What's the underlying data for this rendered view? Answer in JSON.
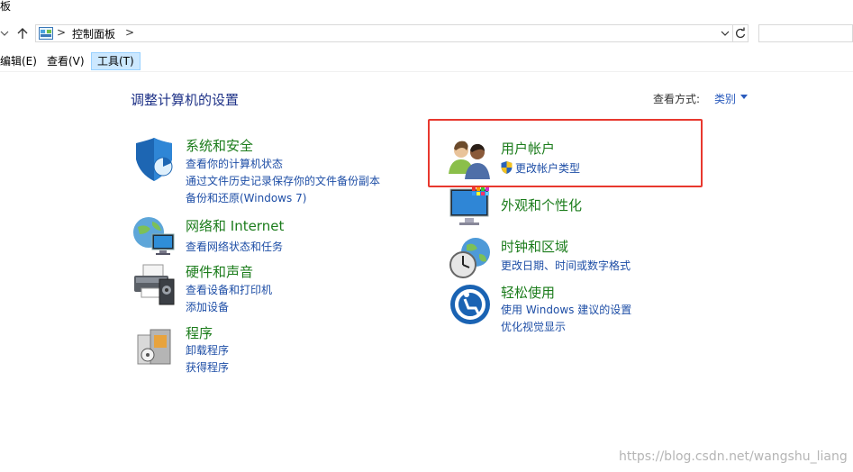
{
  "window": {
    "title": "板"
  },
  "address": {
    "crumb": "控制面板",
    "separator": ">"
  },
  "menu": {
    "edit": "编辑(E)",
    "view": "查看(V)",
    "tools": "工具(T)"
  },
  "main": {
    "heading": "调整计算机的设置",
    "view_by_label": "查看方式:",
    "view_by_value": "类别"
  },
  "categories": {
    "security": {
      "title": "系统和安全",
      "links": [
        "查看你的计算机状态",
        "通过文件历史记录保存你的文件备份副本",
        "备份和还原(Windows 7)"
      ]
    },
    "network": {
      "title": "网络和 Internet",
      "links": [
        "查看网络状态和任务"
      ]
    },
    "hardware": {
      "title": "硬件和声音",
      "links": [
        "查看设备和打印机",
        "添加设备"
      ]
    },
    "programs": {
      "title": "程序",
      "links": [
        "卸载程序",
        "获得程序"
      ]
    },
    "accounts": {
      "title": "用户帐户",
      "links": [
        "更改帐户类型"
      ]
    },
    "appearance": {
      "title": "外观和个性化",
      "links": []
    },
    "clock": {
      "title": "时钟和区域",
      "links": [
        "更改日期、时间或数字格式"
      ]
    },
    "ease": {
      "title": "轻松使用",
      "links": [
        "使用 Windows 建议的设置",
        "优化视觉显示"
      ]
    }
  },
  "watermark": "https://blog.csdn.net/wangshu_liang",
  "colors": {
    "link": "#1e4ea6",
    "category_title": "#1b7c1b",
    "heading": "#1e3287",
    "highlight": "#e8382e"
  },
  "icons": {
    "security": "shield-pie-icon",
    "network": "globe-monitor-icon",
    "hardware": "printer-icon",
    "programs": "program-box-icon",
    "accounts": "users-icon",
    "appearance": "monitor-palette-icon",
    "clock": "clock-globe-icon",
    "ease": "ease-of-access-icon"
  }
}
